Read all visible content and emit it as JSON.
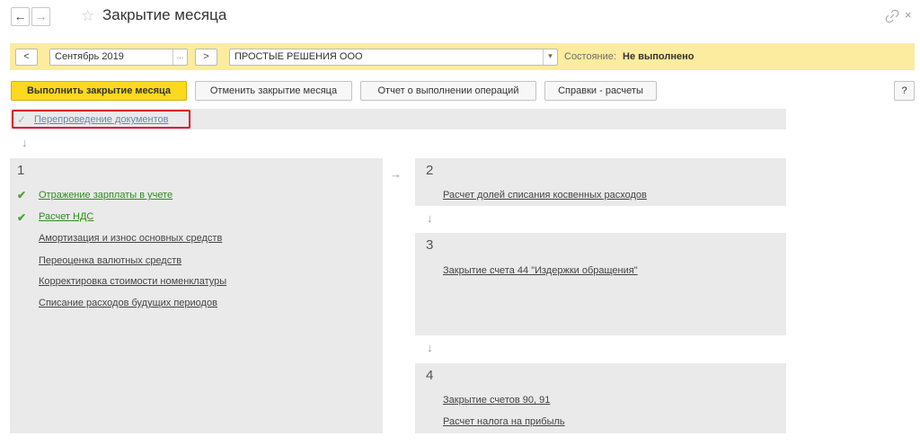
{
  "window": {
    "title": "Закрытие месяца",
    "back_icon": "←",
    "forward_icon": "→",
    "favorite_icon": "☆",
    "close_icon": "×"
  },
  "filter_bar": {
    "prev_label": "<",
    "period_value": "Сентябрь 2019",
    "period_picker_label": "...",
    "next_label": ">",
    "organization_value": "ПРОСТЫЕ РЕШЕНИЯ ООО",
    "organization_dropdown_icon": "▾",
    "state_label": "Состояние:",
    "state_value": "Не выполнено"
  },
  "toolbar": {
    "execute_label": "Выполнить закрытие месяца",
    "cancel_label": "Отменить закрытие месяца",
    "report_label": "Отчет о выполнении операций",
    "calc_label": "Справки - расчеты",
    "help_label": "?"
  },
  "repost": {
    "check_icon": "✓",
    "label": "Перепроведение документов"
  },
  "step1": {
    "number": "1",
    "items": [
      {
        "label": "Отражение зарплаты в учете",
        "done": true
      },
      {
        "label": "Расчет НДС",
        "done": true
      },
      {
        "label": "Амортизация и износ основных средств",
        "done": false
      },
      {
        "label": "Переоценка валютных средств",
        "done": false
      },
      {
        "label": "Корректировка стоимости номенклатуры",
        "done": false
      },
      {
        "label": "Списание расходов будущих периодов",
        "done": false
      }
    ]
  },
  "step2": {
    "number": "2",
    "items": [
      {
        "label": "Расчет долей списания косвенных расходов"
      }
    ]
  },
  "step3": {
    "number": "3",
    "items": [
      {
        "label": "Закрытие счета 44 \"Издержки обращения\""
      }
    ]
  },
  "step4": {
    "number": "4",
    "items": [
      {
        "label": "Закрытие счетов 90, 91"
      },
      {
        "label": "Расчет налога на прибыль"
      }
    ]
  },
  "arrows": {
    "down": "↓",
    "right": "→"
  },
  "colors": {
    "accent_yellow": "#fbd91e",
    "state_bar": "#fbec9f",
    "done_green": "#2f8c1f",
    "highlight_red": "#e0101e"
  }
}
